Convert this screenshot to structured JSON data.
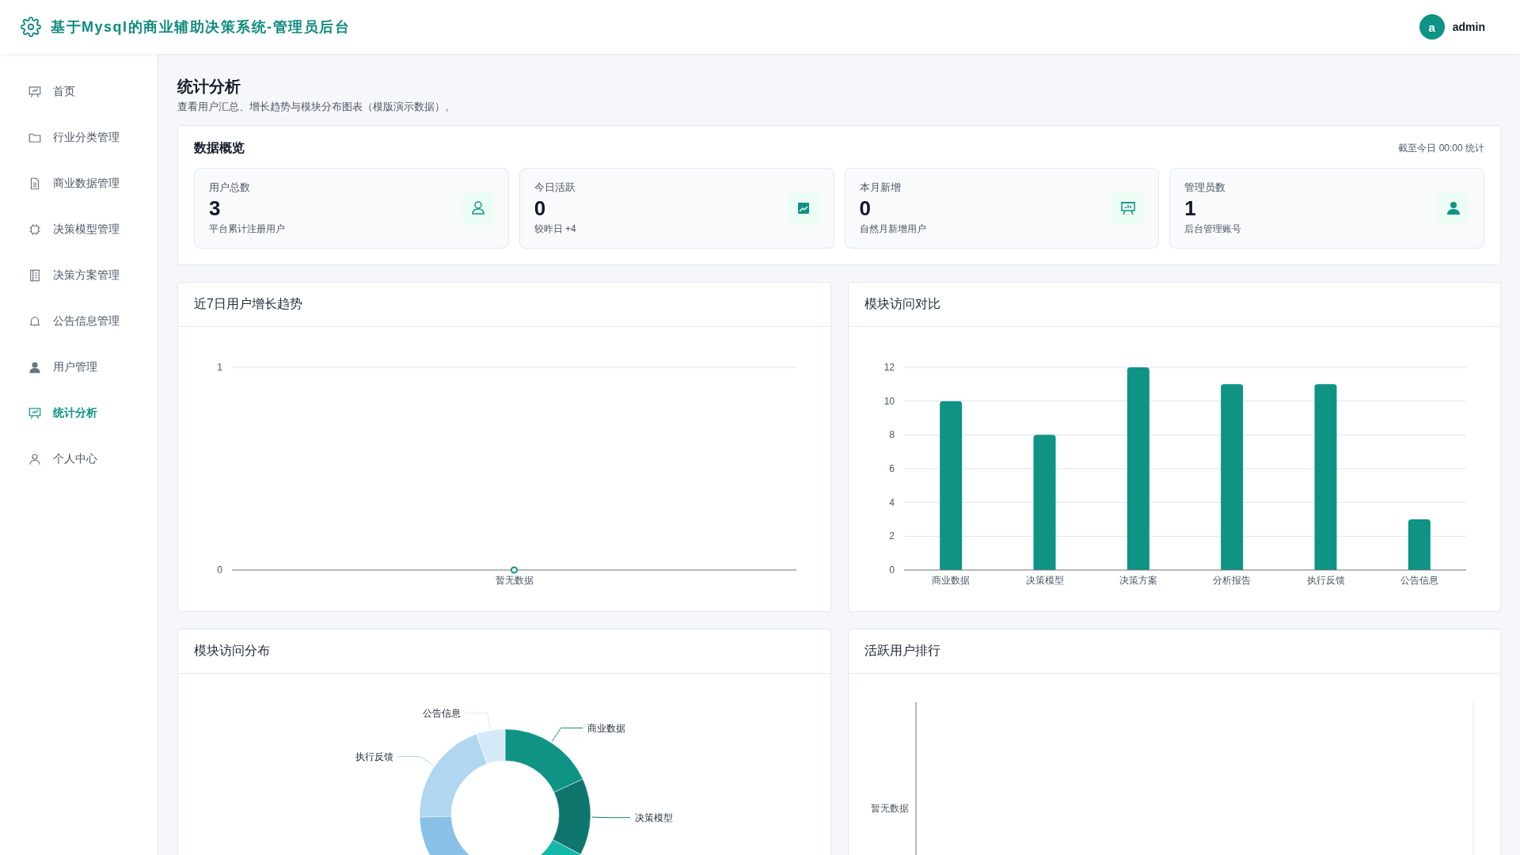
{
  "header": {
    "title": "基于Mysql的商业辅助决策系统-管理员后台",
    "avatar": "a",
    "username": "admin"
  },
  "sidebar": {
    "items": [
      {
        "label": "首页",
        "selected": false
      },
      {
        "label": "行业分类管理",
        "selected": false
      },
      {
        "label": "商业数据管理",
        "selected": false
      },
      {
        "label": "决策模型管理",
        "selected": false
      },
      {
        "label": "决策方案管理",
        "selected": false
      },
      {
        "label": "公告信息管理",
        "selected": false
      },
      {
        "label": "用户管理",
        "selected": false
      },
      {
        "label": "统计分析",
        "selected": true
      },
      {
        "label": "个人中心",
        "selected": false
      }
    ]
  },
  "page": {
    "title": "统计分析",
    "subtitle": "查看用户汇总、增长趋势与模块分布图表（模版演示数据）。"
  },
  "overview": {
    "title": "数据概览",
    "note": "截至今日 00:00 统计",
    "stats": [
      {
        "label": "用户总数",
        "value": "3",
        "caption": "平台累计注册用户"
      },
      {
        "label": "今日活跃",
        "value": "0",
        "caption": "较昨日 +4"
      },
      {
        "label": "本月新增",
        "value": "0",
        "caption": "自然月新增用户"
      },
      {
        "label": "管理员数",
        "value": "1",
        "caption": "后台管理账号"
      }
    ]
  },
  "charts": [
    {
      "title": "近7日用户增长趋势",
      "chart_data": {
        "type": "line",
        "categories": [
          "暂无数据"
        ],
        "series": [
          {
            "color": "#0e9384",
            "values": [
              0
            ],
            "marker": true
          }
        ],
        "ylim": [
          0,
          1
        ],
        "yticks": [
          0,
          1
        ],
        "grid": true
      }
    },
    {
      "title": "模块访问对比",
      "chart_data": {
        "type": "bar",
        "categories": [
          "商业数据",
          "决策模型",
          "决策方案",
          "分析报告",
          "执行反馈",
          "公告信息"
        ],
        "series": [
          {
            "color": "#0e9384",
            "values": [
              10,
              8,
              12,
              11,
              11,
              3
            ]
          }
        ],
        "ylim": [
          0,
          12
        ],
        "yticks": [
          0,
          2,
          4,
          6,
          8,
          10,
          12
        ],
        "grid": true
      }
    },
    {
      "title": "模块访问分布",
      "chart_data": {
        "type": "donut",
        "categories": [
          "商业数据",
          "决策模型",
          null,
          null,
          "执行反馈",
          "公告信息"
        ],
        "series": [
          {
            "values": [
              18.18,
              14.55,
              21.82,
              20,
              20,
              5.45
            ]
          }
        ]
      }
    },
    {
      "title": "活跃用户排行",
      "empty_label": "暂无数据"
    }
  ]
}
